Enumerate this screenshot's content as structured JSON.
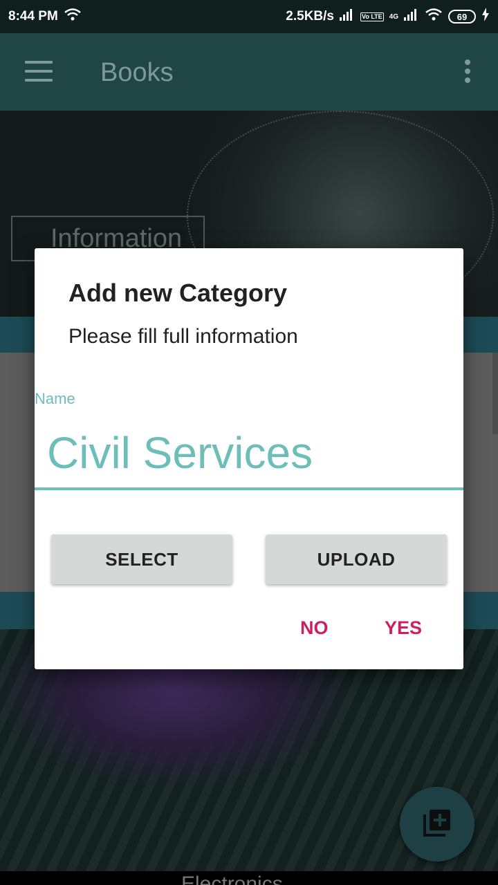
{
  "status_bar": {
    "time": "8:44 PM",
    "network_speed": "2.5KB/s",
    "volte": "Vo LTE",
    "network_type": "4G",
    "battery": "69",
    "icons": [
      "wifi-icon",
      "signal-icon",
      "battery-icon",
      "charging-icon"
    ]
  },
  "app_bar": {
    "title": "Books",
    "icons": [
      "menu-icon",
      "overflow-menu-icon"
    ]
  },
  "background": {
    "card_1_label": "Information",
    "card_3_label": "Electronics"
  },
  "dialog": {
    "title": "Add new Category",
    "message": "Please fill full information",
    "name_label": "Name",
    "name_value": "Civil Services",
    "select_label": "SELECT",
    "upload_label": "UPLOAD",
    "no_label": "NO",
    "yes_label": "YES"
  },
  "fab": {
    "icon": "add-to-library-icon"
  },
  "colors": {
    "accent": "#6dbdb8",
    "dialog_action": "#cc1f66",
    "app_bar": "#1f4645"
  }
}
